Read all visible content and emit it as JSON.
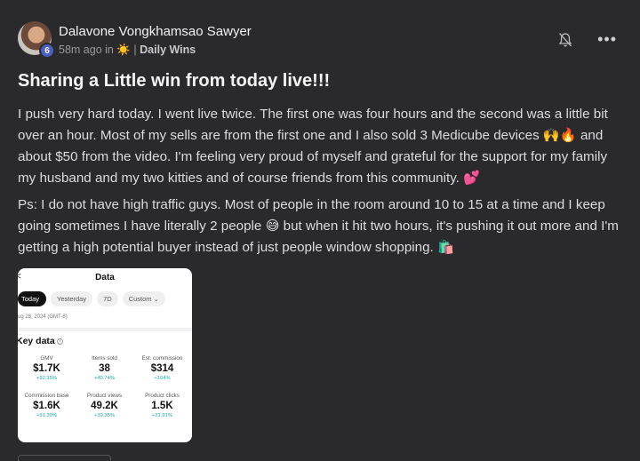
{
  "post": {
    "author": "Dalavone Vongkhamsao Sawyer",
    "level": "6",
    "time_ago": "58m ago in",
    "group": "Daily Wins",
    "title": "Sharing a Little win from today live!!!",
    "paragraph1": "I push very hard today. I went live twice. The first one was four hours and the second was a little bit over an hour. Most of my sells are from the first one and I also sold 3 Medicube devices 🙌🔥 and about $50 from the video. I'm feeling very proud of myself and grateful for the support for my family my husband and my two kitties and of course friends from this community. 💕",
    "paragraph2": "Ps: I do not have high traffic guys. Most of people in the room around 10 to 15 at a time and I keep going sometimes I have literally 2 people 😅 but when it hit two hours, it's pushing it out more and I'm getting a high potential buyer instead of just people window shopping. 🛍️"
  },
  "icons": {
    "sun": "☀️",
    "bell": "bell-off-icon",
    "more": "•••"
  },
  "screenshot": {
    "title": "Data",
    "back": "<",
    "tabs": [
      "Today",
      "Yesterday",
      "7D",
      "Custom ⌄"
    ],
    "date": "ug 28, 2024 (GMT-8)",
    "key_title": "Key data",
    "metrics": [
      {
        "label": "GMV",
        "value": "$1.7K",
        "change": "+92.35%"
      },
      {
        "label": "Items sold",
        "value": "38",
        "change": "+40.74%"
      },
      {
        "label": "Est. commission",
        "value": "$314",
        "change": "+104%"
      },
      {
        "label": "Commission base",
        "value": "$1.6K",
        "change": "+91.30%"
      },
      {
        "label": "Product views",
        "value": "49.2K",
        "change": "+39.35%"
      },
      {
        "label": "Product clicks",
        "value": "1.5K",
        "change": "+21.91%"
      }
    ]
  },
  "colors": {
    "background": "#2a2a2c",
    "badge": "#4a5fc6",
    "positive_change": "#1aa6a6"
  }
}
